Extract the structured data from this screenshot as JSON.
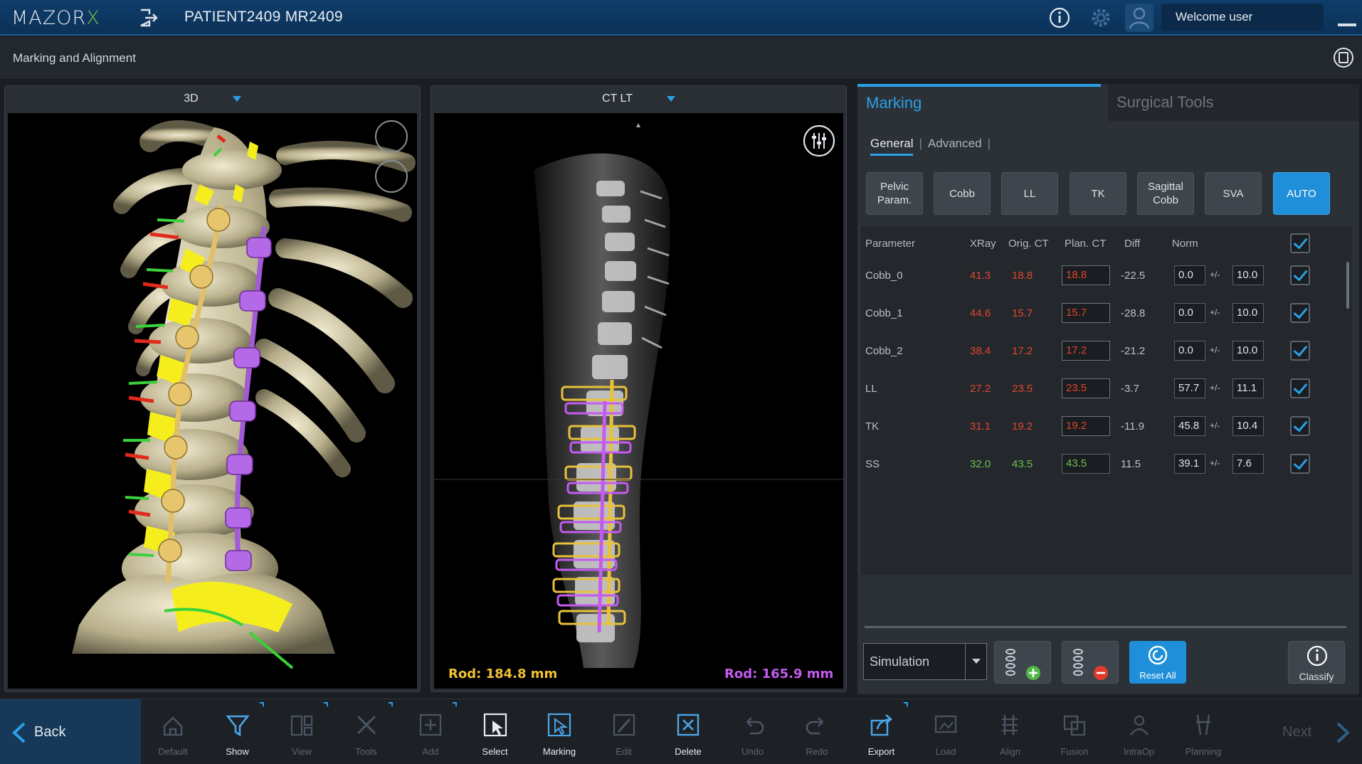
{
  "app": {
    "logo_main": "MAZOR",
    "logo_x": "X",
    "patient": "PATIENT2409 MR2409",
    "welcome": "Welcome user",
    "screen_title": "Marking and Alignment",
    "colors": {
      "accent": "#2aa0e6",
      "brand_x": "#7fc241",
      "red_value": "#e0452d",
      "green_value": "#6fc24a",
      "rod_left": "#f1c232",
      "rod_right": "#c55bf0"
    }
  },
  "viewports": {
    "left": {
      "title": "3D",
      "rod_label": "Rod: 184.8 mm"
    },
    "right": {
      "title": "CT LT",
      "rod_label": "Rod: 165.9 mm"
    }
  },
  "panel": {
    "tabs": [
      "Marking",
      "Surgical Tools"
    ],
    "subtabs": [
      "General",
      "Advanced"
    ],
    "buttons": [
      {
        "label_1": "Pelvic",
        "label_2": "Param."
      },
      {
        "label_1": "Cobb",
        "label_2": ""
      },
      {
        "label_1": "LL",
        "label_2": ""
      },
      {
        "label_1": "TK",
        "label_2": ""
      },
      {
        "label_1": "Sagittal",
        "label_2": "Cobb"
      },
      {
        "label_1": "SVA",
        "label_2": ""
      },
      {
        "label_1": "AUTO",
        "label_2": ""
      }
    ],
    "table": {
      "headers": [
        "Parameter",
        "XRay",
        "Orig. CT",
        "Plan. CT",
        "Diff",
        "Norm"
      ],
      "pm": "+/-",
      "rows": [
        {
          "param": "Cobb_0",
          "xray": "41.3",
          "orig": "18.8",
          "plan": "18.8",
          "diff": "-22.5",
          "norm": "0.0",
          "tol": "10.0",
          "status": "red"
        },
        {
          "param": "Cobb_1",
          "xray": "44.6",
          "orig": "15.7",
          "plan": "15.7",
          "diff": "-28.8",
          "norm": "0.0",
          "tol": "10.0",
          "status": "red"
        },
        {
          "param": "Cobb_2",
          "xray": "38.4",
          "orig": "17.2",
          "plan": "17.2",
          "diff": "-21.2",
          "norm": "0.0",
          "tol": "10.0",
          "status": "red"
        },
        {
          "param": "LL",
          "xray": "27.2",
          "orig": "23.5",
          "plan": "23.5",
          "diff": "-3.7",
          "norm": "57.7",
          "tol": "11.1",
          "status": "red"
        },
        {
          "param": "TK",
          "xray": "31.1",
          "orig": "19.2",
          "plan": "19.2",
          "diff": "-11.9",
          "norm": "45.8",
          "tol": "10.4",
          "status": "red"
        },
        {
          "param": "SS",
          "xray": "32.0",
          "orig": "43.5",
          "plan": "43.5",
          "diff": "11.5",
          "norm": "39.1",
          "tol": "7.6",
          "status": "green"
        }
      ]
    },
    "simulation": "Simulation",
    "reset_all": "Reset All",
    "classify": "Classify"
  },
  "toolbar": {
    "back": "Back",
    "next": "Next",
    "items": [
      {
        "label": "Default",
        "state": "dim"
      },
      {
        "label": "Show",
        "state": "active"
      },
      {
        "label": "View",
        "state": "dim"
      },
      {
        "label": "Tools",
        "state": "dim"
      },
      {
        "label": "Add",
        "state": "dim"
      },
      {
        "label": "Select",
        "state": "active"
      },
      {
        "label": "Marking",
        "state": "active"
      },
      {
        "label": "Edit",
        "state": "dim"
      },
      {
        "label": "Delete",
        "state": "active"
      },
      {
        "label": "Undo",
        "state": "dim"
      },
      {
        "label": "Redo",
        "state": "dim"
      },
      {
        "label": "Export",
        "state": "active"
      },
      {
        "label": "Load",
        "state": "dim"
      },
      {
        "label": "Align",
        "state": "dim"
      },
      {
        "label": "Fusion",
        "state": "dim"
      },
      {
        "label": "IntraOp",
        "state": "dim"
      },
      {
        "label": "Planning",
        "state": "dim"
      }
    ]
  }
}
